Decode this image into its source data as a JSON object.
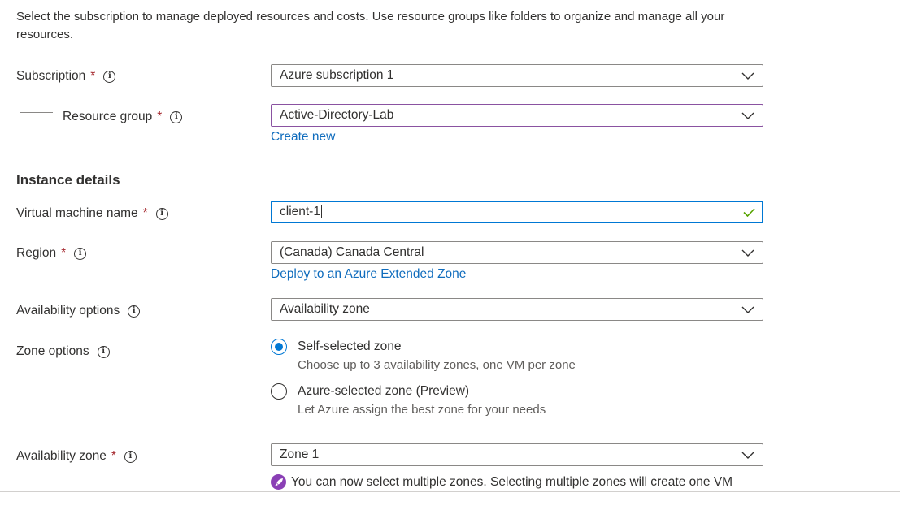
{
  "intro": "Select the subscription to manage deployed resources and costs. Use resource groups like folders to organize and manage all your resources.",
  "required_marker": "*",
  "info_glyph": "i",
  "fields": {
    "subscription": {
      "label": "Subscription",
      "value": "Azure subscription 1"
    },
    "resource_group": {
      "label": "Resource group",
      "value": "Active-Directory-Lab",
      "link": "Create new"
    },
    "vm_name": {
      "label": "Virtual machine name",
      "value": "client-1"
    },
    "region": {
      "label": "Region",
      "value": "(Canada) Canada Central",
      "link": "Deploy to an Azure Extended Zone"
    },
    "availability_options": {
      "label": "Availability options",
      "value": "Availability zone"
    },
    "zone_options": {
      "label": "Zone options",
      "options": [
        {
          "label": "Self-selected zone",
          "description": "Choose up to 3 availability zones, one VM per zone",
          "selected": true
        },
        {
          "label": "Azure-selected zone (Preview)",
          "description": "Let Azure assign the best zone for your needs",
          "selected": false
        }
      ]
    },
    "availability_zone": {
      "label": "Availability zone",
      "value": "Zone 1"
    }
  },
  "section_heading": "Instance details",
  "notice": "You can now select multiple zones. Selecting multiple zones will create one VM",
  "colors": {
    "accent": "#0078d4",
    "link": "#0f6cbd",
    "required": "#a4262c",
    "valid_check": "#57a300",
    "notice_icon": "#8a3fb5"
  }
}
